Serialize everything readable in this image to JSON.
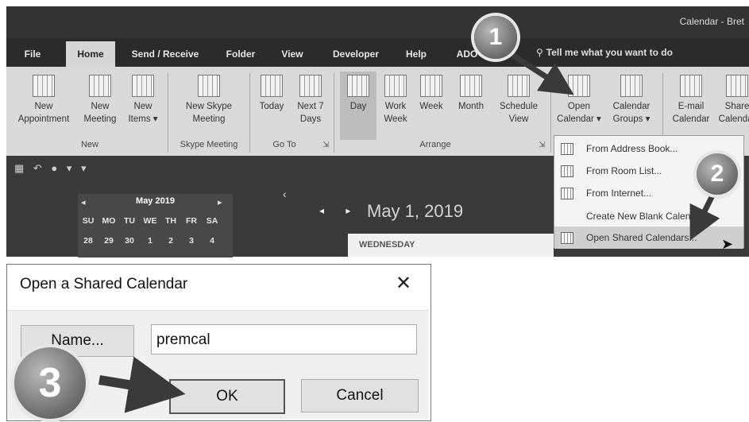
{
  "window": {
    "title": "Calendar - Bret"
  },
  "tabs": [
    {
      "label": "File"
    },
    {
      "label": "Home"
    },
    {
      "label": "Send / Receive"
    },
    {
      "label": "Folder"
    },
    {
      "label": "View"
    },
    {
      "label": "Developer"
    },
    {
      "label": "Help"
    },
    {
      "label": "ADO"
    }
  ],
  "tell_me": {
    "icon": "lightbulb-icon",
    "label": "Tell me what you want to do"
  },
  "ribbon": {
    "new_appointment": [
      "New",
      "Appointment"
    ],
    "new_meeting": [
      "New",
      "Meeting"
    ],
    "new_items": [
      "New",
      "Items ▾"
    ],
    "new_skype_meeting": [
      "New Skype",
      "Meeting"
    ],
    "today": "Today",
    "next7": [
      "Next 7",
      "Days"
    ],
    "day": "Day",
    "work_week": [
      "Work",
      "Week"
    ],
    "week": "Week",
    "month": "Month",
    "schedule_view": [
      "Schedule",
      "View"
    ],
    "open_calendar": [
      "Open",
      "Calendar ▾"
    ],
    "calendar_groups": [
      "Calendar",
      "Groups ▾"
    ],
    "email_calendar": [
      "E-mail",
      "Calendar"
    ],
    "share_calendar": [
      "Share",
      "Calendar"
    ],
    "groups": {
      "new": "New",
      "skype": "Skype Meeting",
      "goto": "Go To",
      "arrange": "Arrange"
    }
  },
  "mini_calendar": {
    "month": "May 2019",
    "weekdays": [
      "SU",
      "MO",
      "TU",
      "WE",
      "TH",
      "FR",
      "SA"
    ],
    "days": [
      "28",
      "29",
      "30",
      "1",
      "2",
      "3",
      "4"
    ]
  },
  "main": {
    "date": "May 1, 2019",
    "weekday": "WEDNESDAY"
  },
  "dropdown": {
    "items": [
      {
        "label": "From Address Book..."
      },
      {
        "label": "From Room List..."
      },
      {
        "label": "From Internet..."
      },
      {
        "label": "Create New Blank Calen"
      },
      {
        "label": "Open Shared Calendars..."
      }
    ]
  },
  "callouts": [
    "1",
    "2",
    "3"
  ],
  "dialog": {
    "title": "Open a Shared Calendar",
    "close": "✕",
    "name_button": "Name...",
    "name_value": "premcal",
    "ok": "OK",
    "cancel": "Cancel"
  },
  "colors": {
    "ribbon_bg": "#d9d9d9",
    "dark_bg": "#2b2b2b",
    "dialog_bg": "#f0f0f0"
  }
}
